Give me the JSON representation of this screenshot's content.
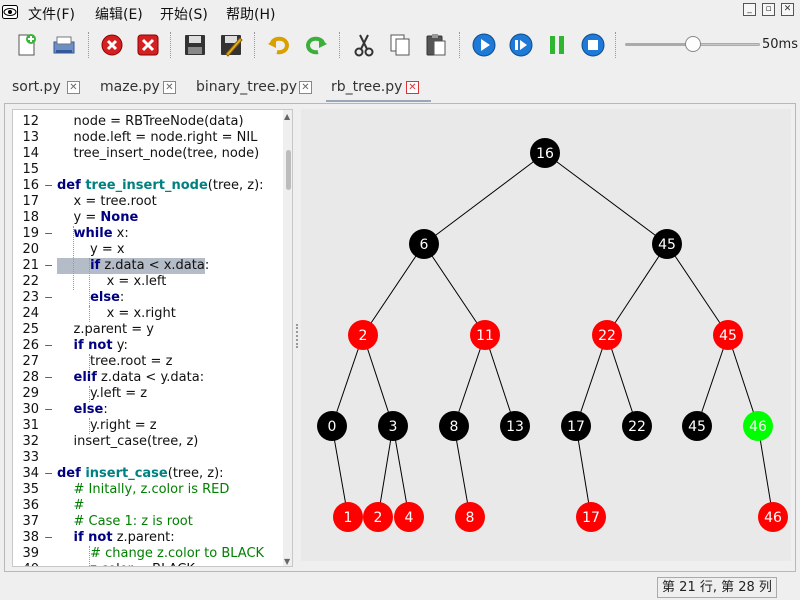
{
  "menu": [
    "文件(F)",
    "编辑(E)",
    "开始(S)",
    "帮助(H)"
  ],
  "toolbar": {
    "buttons": [
      "new-file",
      "open-file",
      "close",
      "close-all",
      "save",
      "save-as",
      "undo",
      "redo",
      "cut",
      "copy",
      "paste",
      "run",
      "step",
      "pause",
      "stop"
    ],
    "speed_label": "50ms",
    "speed_fraction": 0.5
  },
  "tabs": [
    {
      "label": "sort.py",
      "active": false
    },
    {
      "label": "maze.py",
      "active": false
    },
    {
      "label": "binary_tree.py",
      "active": false
    },
    {
      "label": "rb_tree.py",
      "active": true
    }
  ],
  "editor": {
    "highlight_line": 21,
    "lines": [
      {
        "n": "12",
        "fold": "",
        "segs": [
          [
            "",
            "    node = RBTreeNode(data)"
          ]
        ]
      },
      {
        "n": "13",
        "fold": "",
        "segs": [
          [
            "",
            "    node.left = node.right = NIL"
          ]
        ]
      },
      {
        "n": "14",
        "fold": "",
        "segs": [
          [
            "",
            "    tree_insert_node(tree, node)"
          ]
        ]
      },
      {
        "n": "15",
        "fold": "",
        "segs": [
          [
            "",
            ""
          ]
        ]
      },
      {
        "n": "16",
        "fold": "−",
        "segs": [
          [
            "kw",
            "def "
          ],
          [
            "fn",
            "tree_insert_node"
          ],
          [
            "",
            "(tree, z):"
          ]
        ]
      },
      {
        "n": "17",
        "fold": "",
        "segs": [
          [
            "",
            "    x = tree.root"
          ]
        ]
      },
      {
        "n": "18",
        "fold": "",
        "segs": [
          [
            "",
            "    y = "
          ],
          [
            "kw",
            "None"
          ]
        ]
      },
      {
        "n": "19",
        "fold": "−",
        "segs": [
          [
            "",
            "    "
          ],
          [
            "kw",
            "while"
          ],
          [
            "",
            " x:"
          ]
        ]
      },
      {
        "n": "20",
        "fold": "",
        "segs": [
          [
            "",
            "        y = x"
          ]
        ]
      },
      {
        "n": "21",
        "fold": "−",
        "segs": [
          [
            "",
            "        "
          ],
          [
            "kw",
            "if"
          ],
          [
            "",
            " z.data < x.data:"
          ]
        ]
      },
      {
        "n": "22",
        "fold": "",
        "segs": [
          [
            "",
            "            x = x.left"
          ]
        ]
      },
      {
        "n": "23",
        "fold": "−",
        "segs": [
          [
            "",
            "        "
          ],
          [
            "kw",
            "else"
          ],
          [
            "",
            ":"
          ]
        ]
      },
      {
        "n": "24",
        "fold": "",
        "segs": [
          [
            "",
            "            x = x.right"
          ]
        ]
      },
      {
        "n": "25",
        "fold": "",
        "segs": [
          [
            "",
            "    z.parent = y"
          ]
        ]
      },
      {
        "n": "26",
        "fold": "−",
        "segs": [
          [
            "",
            "    "
          ],
          [
            "kw",
            "if not"
          ],
          [
            "",
            " y:"
          ]
        ]
      },
      {
        "n": "27",
        "fold": "",
        "segs": [
          [
            "",
            "        tree.root = z"
          ]
        ]
      },
      {
        "n": "28",
        "fold": "−",
        "segs": [
          [
            "",
            "    "
          ],
          [
            "kw",
            "elif"
          ],
          [
            "",
            " z.data < y.data:"
          ]
        ]
      },
      {
        "n": "29",
        "fold": "",
        "segs": [
          [
            "",
            "        y.left = z"
          ]
        ]
      },
      {
        "n": "30",
        "fold": "−",
        "segs": [
          [
            "",
            "    "
          ],
          [
            "kw",
            "else"
          ],
          [
            "",
            ":"
          ]
        ]
      },
      {
        "n": "31",
        "fold": "",
        "segs": [
          [
            "",
            "        y.right = z"
          ]
        ]
      },
      {
        "n": "32",
        "fold": "",
        "segs": [
          [
            "",
            "    insert_case(tree, z)"
          ]
        ]
      },
      {
        "n": "33",
        "fold": "",
        "segs": [
          [
            "",
            ""
          ]
        ]
      },
      {
        "n": "34",
        "fold": "−",
        "segs": [
          [
            "kw",
            "def "
          ],
          [
            "fn",
            "insert_case"
          ],
          [
            "",
            "(tree, z):"
          ]
        ]
      },
      {
        "n": "35",
        "fold": "",
        "segs": [
          [
            "",
            "    "
          ],
          [
            "cm",
            "# Initally, z.color is RED"
          ]
        ]
      },
      {
        "n": "36",
        "fold": "",
        "segs": [
          [
            "",
            "    "
          ],
          [
            "cm",
            "#"
          ]
        ]
      },
      {
        "n": "37",
        "fold": "",
        "segs": [
          [
            "",
            "    "
          ],
          [
            "cm",
            "# Case 1: z is root"
          ]
        ]
      },
      {
        "n": "38",
        "fold": "−",
        "segs": [
          [
            "",
            "    "
          ],
          [
            "kw",
            "if not"
          ],
          [
            "",
            " z.parent:"
          ]
        ]
      },
      {
        "n": "39",
        "fold": "",
        "segs": [
          [
            "",
            "        "
          ],
          [
            "cm",
            "# change z.color to BLACK"
          ]
        ]
      },
      {
        "n": "40",
        "fold": "",
        "segs": [
          [
            "",
            "        z.color = BLACK"
          ]
        ]
      }
    ]
  },
  "tree": {
    "colors": {
      "black": "#000000",
      "red": "#ff0000",
      "green": "#00ff00"
    },
    "nodes": [
      {
        "id": "a",
        "label": "16",
        "color": "black",
        "parent": null
      },
      {
        "id": "b",
        "label": "6",
        "color": "black",
        "parent": "a"
      },
      {
        "id": "c",
        "label": "45",
        "color": "black",
        "parent": "a"
      },
      {
        "id": "d",
        "label": "2",
        "color": "red",
        "parent": "b"
      },
      {
        "id": "e",
        "label": "11",
        "color": "red",
        "parent": "b"
      },
      {
        "id": "f",
        "label": "22",
        "color": "red",
        "parent": "c"
      },
      {
        "id": "g",
        "label": "45",
        "color": "red",
        "parent": "c"
      },
      {
        "id": "h",
        "label": "0",
        "color": "black",
        "parent": "d"
      },
      {
        "id": "i",
        "label": "3",
        "color": "black",
        "parent": "d"
      },
      {
        "id": "j",
        "label": "8",
        "color": "black",
        "parent": "e"
      },
      {
        "id": "k",
        "label": "13",
        "color": "black",
        "parent": "e"
      },
      {
        "id": "l",
        "label": "17",
        "color": "black",
        "parent": "f"
      },
      {
        "id": "m",
        "label": "22",
        "color": "black",
        "parent": "f"
      },
      {
        "id": "n",
        "label": "45",
        "color": "black",
        "parent": "g"
      },
      {
        "id": "o",
        "label": "46",
        "color": "green",
        "parent": "g"
      },
      {
        "id": "p",
        "label": "1",
        "color": "red",
        "parent": "h"
      },
      {
        "id": "q",
        "label": "2",
        "color": "red",
        "parent": "i"
      },
      {
        "id": "r",
        "label": "4",
        "color": "red",
        "parent": "i"
      },
      {
        "id": "s",
        "label": "8",
        "color": "red",
        "parent": "j"
      },
      {
        "id": "t",
        "label": "17",
        "color": "red",
        "parent": "l"
      },
      {
        "id": "u",
        "label": "46",
        "color": "red",
        "parent": "o"
      }
    ]
  },
  "status": "第 21 行, 第 28 列"
}
